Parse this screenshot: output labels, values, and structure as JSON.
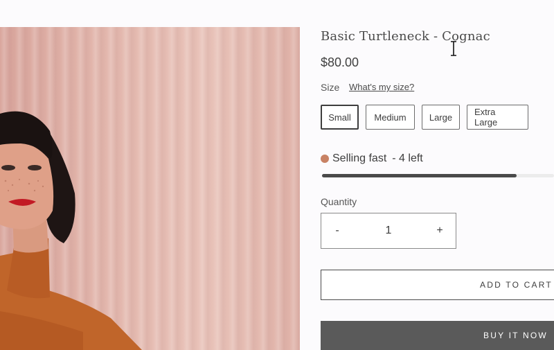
{
  "product": {
    "title": "Basic Turtleneck - Cognac",
    "price": "$80.00"
  },
  "size": {
    "label": "Size",
    "guide_link": "What's my size?",
    "options": [
      "Small",
      "Medium",
      "Large",
      "Extra Large"
    ],
    "selected": "Small"
  },
  "stock": {
    "status": "Selling fast",
    "count_text": "- 4 left",
    "level": 0.84,
    "dot_color": "#c88264"
  },
  "quantity": {
    "label": "Quantity",
    "minus": "-",
    "value": "1",
    "plus": "+"
  },
  "actions": {
    "add_to_cart": "ADD TO CART",
    "buy_now": "BUY IT NOW"
  },
  "icons": {
    "cursor": "text-cursor-icon"
  }
}
